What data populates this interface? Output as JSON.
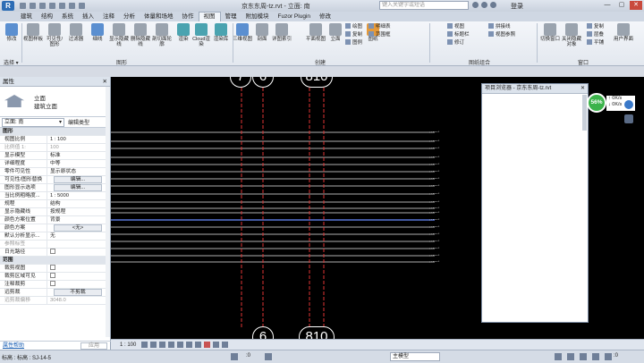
{
  "window": {
    "app_button": "R",
    "title": "京东东周-tz.rvt - 立面: 南",
    "search_placeholder": "键入关键字或短语",
    "login": "登录",
    "controls": [
      "—",
      "▢",
      "✕"
    ]
  },
  "tabs": [
    "建筑",
    "结构",
    "系统",
    "插入",
    "注释",
    "分析",
    "体量和场地",
    "协作",
    "视图",
    "管理",
    "附加模块",
    "Fuzor Plugin",
    "修改"
  ],
  "active_tab": "视图",
  "ribbon": {
    "buttons": [
      {
        "label": "修改",
        "icon": "modify-icon",
        "color": "blue"
      },
      {
        "label": "视图样板",
        "icon": "view-template-icon",
        "color": "gray"
      },
      {
        "label": "可见性/图形",
        "icon": "visibility-icon",
        "color": "gray"
      },
      {
        "label": "过滤器",
        "icon": "filter-icon",
        "color": "gray"
      },
      {
        "label": "细线",
        "icon": "thin-lines-icon",
        "color": "blue"
      },
      {
        "label": "显示隐藏线",
        "icon": "show-hidden-icon",
        "color": "gray"
      },
      {
        "label": "删除隐藏线",
        "icon": "remove-hidden-icon",
        "color": "gray"
      },
      {
        "label": "剖切面轮廓",
        "icon": "cut-profile-icon",
        "color": "gray"
      },
      {
        "label": "渲染",
        "icon": "render-icon",
        "color": "teal"
      },
      {
        "label": "Cloud渲染",
        "icon": "cloud-render-icon",
        "color": "teal"
      },
      {
        "label": "渲染库",
        "icon": "render-gallery-icon",
        "color": "teal"
      },
      {
        "label": "三维视图",
        "icon": "3d-view-icon",
        "color": "blue"
      },
      {
        "label": "剖面",
        "icon": "section-icon",
        "color": "gray"
      },
      {
        "label": "详图索引",
        "icon": "callout-icon",
        "color": "gray"
      },
      {
        "label": "平面视图",
        "icon": "plan-view-icon",
        "color": "gray"
      },
      {
        "label": "立面",
        "icon": "elevation-icon",
        "color": "gray"
      },
      {
        "label": "图纸",
        "icon": "sheet-icon",
        "color": "orange"
      },
      {
        "label": "切换窗口",
        "icon": "switch-window-icon",
        "color": "gray"
      },
      {
        "label": "关闭隐藏对象",
        "icon": "close-hidden-icon",
        "color": "gray"
      },
      {
        "label": "用户界面",
        "icon": "user-interface-icon",
        "color": "gray"
      }
    ],
    "small_groups": [
      [
        "绘图",
        "复制",
        "图例"
      ],
      [
        "明细表",
        "范围框",
        ""
      ],
      [
        "视图",
        "标题栏",
        "修订"
      ],
      [
        "拼接线",
        "视图参照",
        ""
      ],
      [
        "复制",
        "层叠",
        "平铺"
      ]
    ],
    "panels": [
      "选择 ▾",
      "图形",
      "创建",
      "图纸组合",
      "窗口"
    ]
  },
  "properties": {
    "title": "属性",
    "close": "✕",
    "family": "立面",
    "type": "建筑立面",
    "view_selector": "立面: 南",
    "edit_type": "编辑类型",
    "rows": [
      {
        "k": "图形",
        "v": "",
        "grp": true
      },
      {
        "k": "视图比例",
        "v": "1 : 100"
      },
      {
        "k": "比例值 1:",
        "v": "100",
        "dis": true
      },
      {
        "k": "显示模型",
        "v": "标准"
      },
      {
        "k": "详细程度",
        "v": "中等"
      },
      {
        "k": "零件可见性",
        "v": "显示原状态"
      },
      {
        "k": "可见性/图形替换",
        "v": "编辑...",
        "btn": true
      },
      {
        "k": "图形显示选项",
        "v": "编辑...",
        "btn": true
      },
      {
        "k": "当比例粗略度...",
        "v": "1 : 5000"
      },
      {
        "k": "规程",
        "v": "结构"
      },
      {
        "k": "显示隐藏线",
        "v": "按规程"
      },
      {
        "k": "颜色方案位置",
        "v": "背景"
      },
      {
        "k": "颜色方案",
        "v": "<无>",
        "btn": true
      },
      {
        "k": "默认分析显示...",
        "v": "无"
      },
      {
        "k": "参照标签",
        "v": "",
        "dis": true
      },
      {
        "k": "日光路径",
        "v": "",
        "chk": true
      },
      {
        "k": "范围",
        "v": "",
        "grp": true
      },
      {
        "k": "裁剪视图",
        "v": "",
        "chk": true
      },
      {
        "k": "裁剪区域可见",
        "v": "",
        "chk": true
      },
      {
        "k": "注释裁剪",
        "v": "",
        "chk": true
      },
      {
        "k": "远剪裁",
        "v": "不剪裁",
        "btn": true
      },
      {
        "k": "远剪裁偏移",
        "v": "3048.0",
        "dis": true
      }
    ],
    "help_link": "属性帮助",
    "apply": "应用"
  },
  "canvas": {
    "top_bubbles": [
      "7",
      "6",
      "810"
    ],
    "bottom_bubbles": [
      "6",
      "810"
    ]
  },
  "project_browser": {
    "title": "项目浏览器 - 京东东周-tz.rvt",
    "close": "✕"
  },
  "perf": {
    "percent": "56%",
    "up": "0K/s",
    "down": "0K/s"
  },
  "view_bar": {
    "scale": "1 : 100"
  },
  "status": {
    "message": "标高 : 标高 : SJ-14-5",
    "coord": ":0",
    "model": "主模型",
    "filter": ":0"
  }
}
